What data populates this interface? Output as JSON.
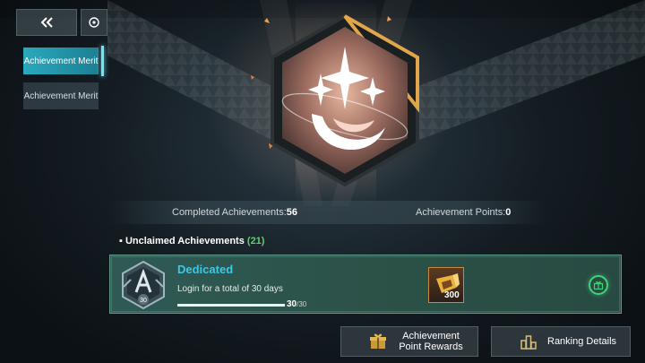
{
  "sidebar": {
    "tabs": [
      {
        "label": "Achievement Merit",
        "active": true
      },
      {
        "label": "Achievement Merit",
        "active": false
      }
    ]
  },
  "stats": {
    "completed_label": "Completed Achievements:",
    "completed_value": "56",
    "points_label": "Achievement Points:",
    "points_value": "0"
  },
  "unclaimed": {
    "label": "Unclaimed Achievements",
    "count": "(21)"
  },
  "achievement": {
    "title": "Dedicated",
    "description": "Login for a total of 30 days",
    "progress_current": "30",
    "progress_total": "/30",
    "progress_fraction": 1.0,
    "badge_level": "30",
    "reward_quantity": "300"
  },
  "buttons": {
    "rewards_label": "Achievement Point Rewards",
    "ranking_label": "Ranking Details"
  },
  "colors": {
    "accent_cyan": "#2aa9bd",
    "title_blue": "#3fc8e6",
    "count_green": "#5fd06c",
    "claim_green": "#41d279"
  },
  "icons": [
    "double-chevron-left-icon",
    "refresh-icon",
    "gift-icon",
    "reward-box-icon",
    "ranking-icon"
  ]
}
